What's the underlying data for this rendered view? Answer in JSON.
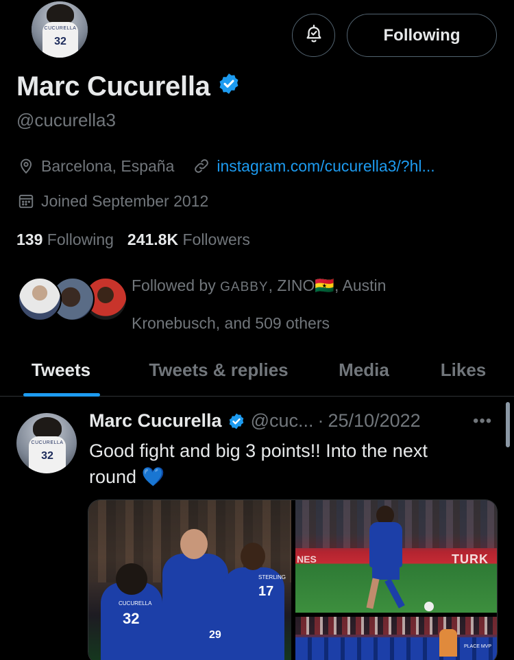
{
  "profile": {
    "name": "Marc Cucurella",
    "handle": "@cucurella3",
    "location": "Barcelona, España",
    "website": "instagram.com/cucurella3/?hl...",
    "joined": "Joined September 2012",
    "following_count": "139",
    "following_label": "Following",
    "followers_count": "241.8K",
    "followers_label": "Followers",
    "avatar_jersey_name": "CUCURELLA",
    "avatar_jersey_number": "32"
  },
  "actions": {
    "follow_state_label": "Following"
  },
  "followed_by": {
    "prefix": "Followed by",
    "name1": "GABBY",
    "name2": "ZINO",
    "flag": "🇬🇭",
    "rest_line1": ", Austin",
    "line2": "Kronebusch, and 509 others"
  },
  "tabs": [
    {
      "label": "Tweets",
      "active": true
    },
    {
      "label": "Tweets & replies",
      "active": false
    },
    {
      "label": "Media",
      "active": false
    },
    {
      "label": "Likes",
      "active": false
    }
  ],
  "tweet": {
    "author_name": "Marc Cucurella",
    "author_handle": "@cuc...",
    "separator": "·",
    "date": "25/10/2022",
    "text_line1": "Good fight and big 3 points!! Into the next",
    "text_line2": "round 💙",
    "more_label": "•••",
    "media": [
      {
        "jersey_name": "CUCURELLA",
        "jersey_number": "32",
        "jersey_number2": "29",
        "jersey_name2": "STERLING",
        "jersey_number3": "17"
      },
      {
        "ad_text": "TURK",
        "ad_text2": "NES"
      },
      {
        "banner_text": "PLACE MVP"
      }
    ]
  },
  "colors": {
    "background": "#000000",
    "primary_text": "#e7e9ea",
    "secondary_text": "#71767b",
    "accent": "#1d9bf0",
    "border": "#2f3336",
    "chelsea_blue": "#1c3fa8"
  }
}
